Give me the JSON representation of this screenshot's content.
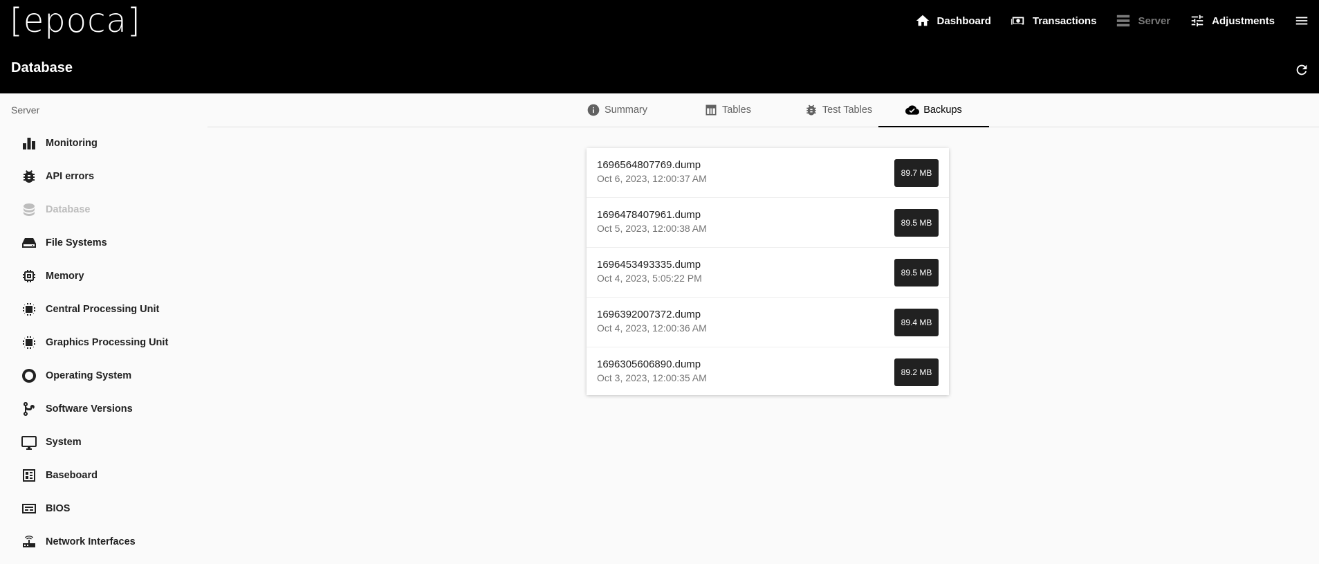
{
  "header": {
    "logo": "[epoca]",
    "page_title": "Database",
    "nav": [
      {
        "label": "Dashboard",
        "icon": "home-icon",
        "disabled": false
      },
      {
        "label": "Transactions",
        "icon": "money-icon",
        "disabled": false
      },
      {
        "label": "Server",
        "icon": "server-icon",
        "disabled": true
      },
      {
        "label": "Adjustments",
        "icon": "tune-icon",
        "disabled": false
      }
    ]
  },
  "sidebar": {
    "heading": "Server",
    "items": [
      {
        "label": "Monitoring",
        "icon": "bar-chart-icon",
        "disabled": false
      },
      {
        "label": "API errors",
        "icon": "bug-icon",
        "disabled": false
      },
      {
        "label": "Database",
        "icon": "database-icon",
        "disabled": true
      },
      {
        "label": "File Systems",
        "icon": "hard-drive-icon",
        "disabled": false
      },
      {
        "label": "Memory",
        "icon": "memory-icon",
        "disabled": false
      },
      {
        "label": "Central Processing Unit",
        "icon": "cpu-icon",
        "disabled": false
      },
      {
        "label": "Graphics Processing Unit",
        "icon": "gpu-icon",
        "disabled": false
      },
      {
        "label": "Operating System",
        "icon": "ubuntu-icon",
        "disabled": false
      },
      {
        "label": "Software Versions",
        "icon": "source-branch-icon",
        "disabled": false
      },
      {
        "label": "System",
        "icon": "monitor-icon",
        "disabled": false
      },
      {
        "label": "Baseboard",
        "icon": "developer-board-icon",
        "disabled": false
      },
      {
        "label": "BIOS",
        "icon": "bios-icon",
        "disabled": false
      },
      {
        "label": "Network Interfaces",
        "icon": "router-icon",
        "disabled": false
      }
    ]
  },
  "tabs": [
    {
      "label": "Summary",
      "icon": "info-icon",
      "active": false
    },
    {
      "label": "Tables",
      "icon": "table-icon",
      "active": false
    },
    {
      "label": "Test Tables",
      "icon": "bug-icon",
      "active": false
    },
    {
      "label": "Backups",
      "icon": "cloud-check-icon",
      "active": true
    }
  ],
  "backups": [
    {
      "name": "1696564807769.dump",
      "date": "Oct 6, 2023, 12:00:37 AM",
      "size": "89.7 MB"
    },
    {
      "name": "1696478407961.dump",
      "date": "Oct 5, 2023, 12:00:38 AM",
      "size": "89.5 MB"
    },
    {
      "name": "1696453493335.dump",
      "date": "Oct 4, 2023, 5:05:22 PM",
      "size": "89.5 MB"
    },
    {
      "name": "1696392007372.dump",
      "date": "Oct 4, 2023, 12:00:36 AM",
      "size": "89.4 MB"
    },
    {
      "name": "1696305606890.dump",
      "date": "Oct 3, 2023, 12:00:35 AM",
      "size": "89.2 MB"
    }
  ]
}
